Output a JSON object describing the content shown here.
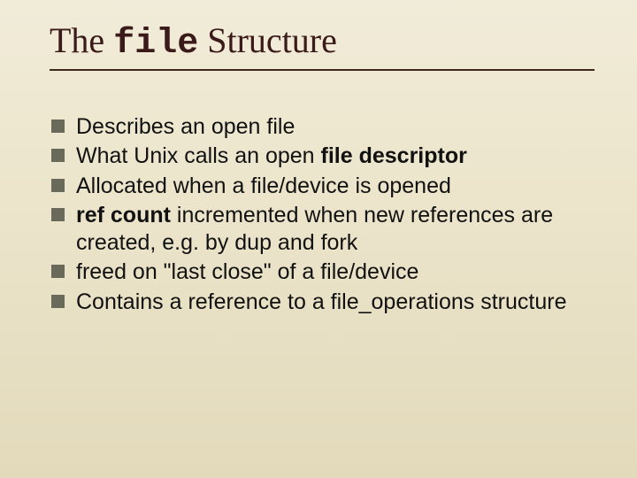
{
  "title": {
    "pre": "The ",
    "code": "file",
    "post": " Structure"
  },
  "bullets": [
    {
      "pre": "Describes an open file",
      "bold": "",
      "post": ""
    },
    {
      "pre": "What Unix calls an open ",
      "bold": "file descriptor",
      "post": ""
    },
    {
      "pre": "Allocated when a file/device is opened",
      "bold": "",
      "post": ""
    },
    {
      "pre": "",
      "bold": "ref count",
      "post": " incremented when new references are created, e.g. by dup and fork"
    },
    {
      "pre": "freed on \"last close\" of a file/device",
      "bold": "",
      "post": ""
    },
    {
      "pre": "Contains a reference to a file_operations structure",
      "bold": "",
      "post": ""
    }
  ]
}
